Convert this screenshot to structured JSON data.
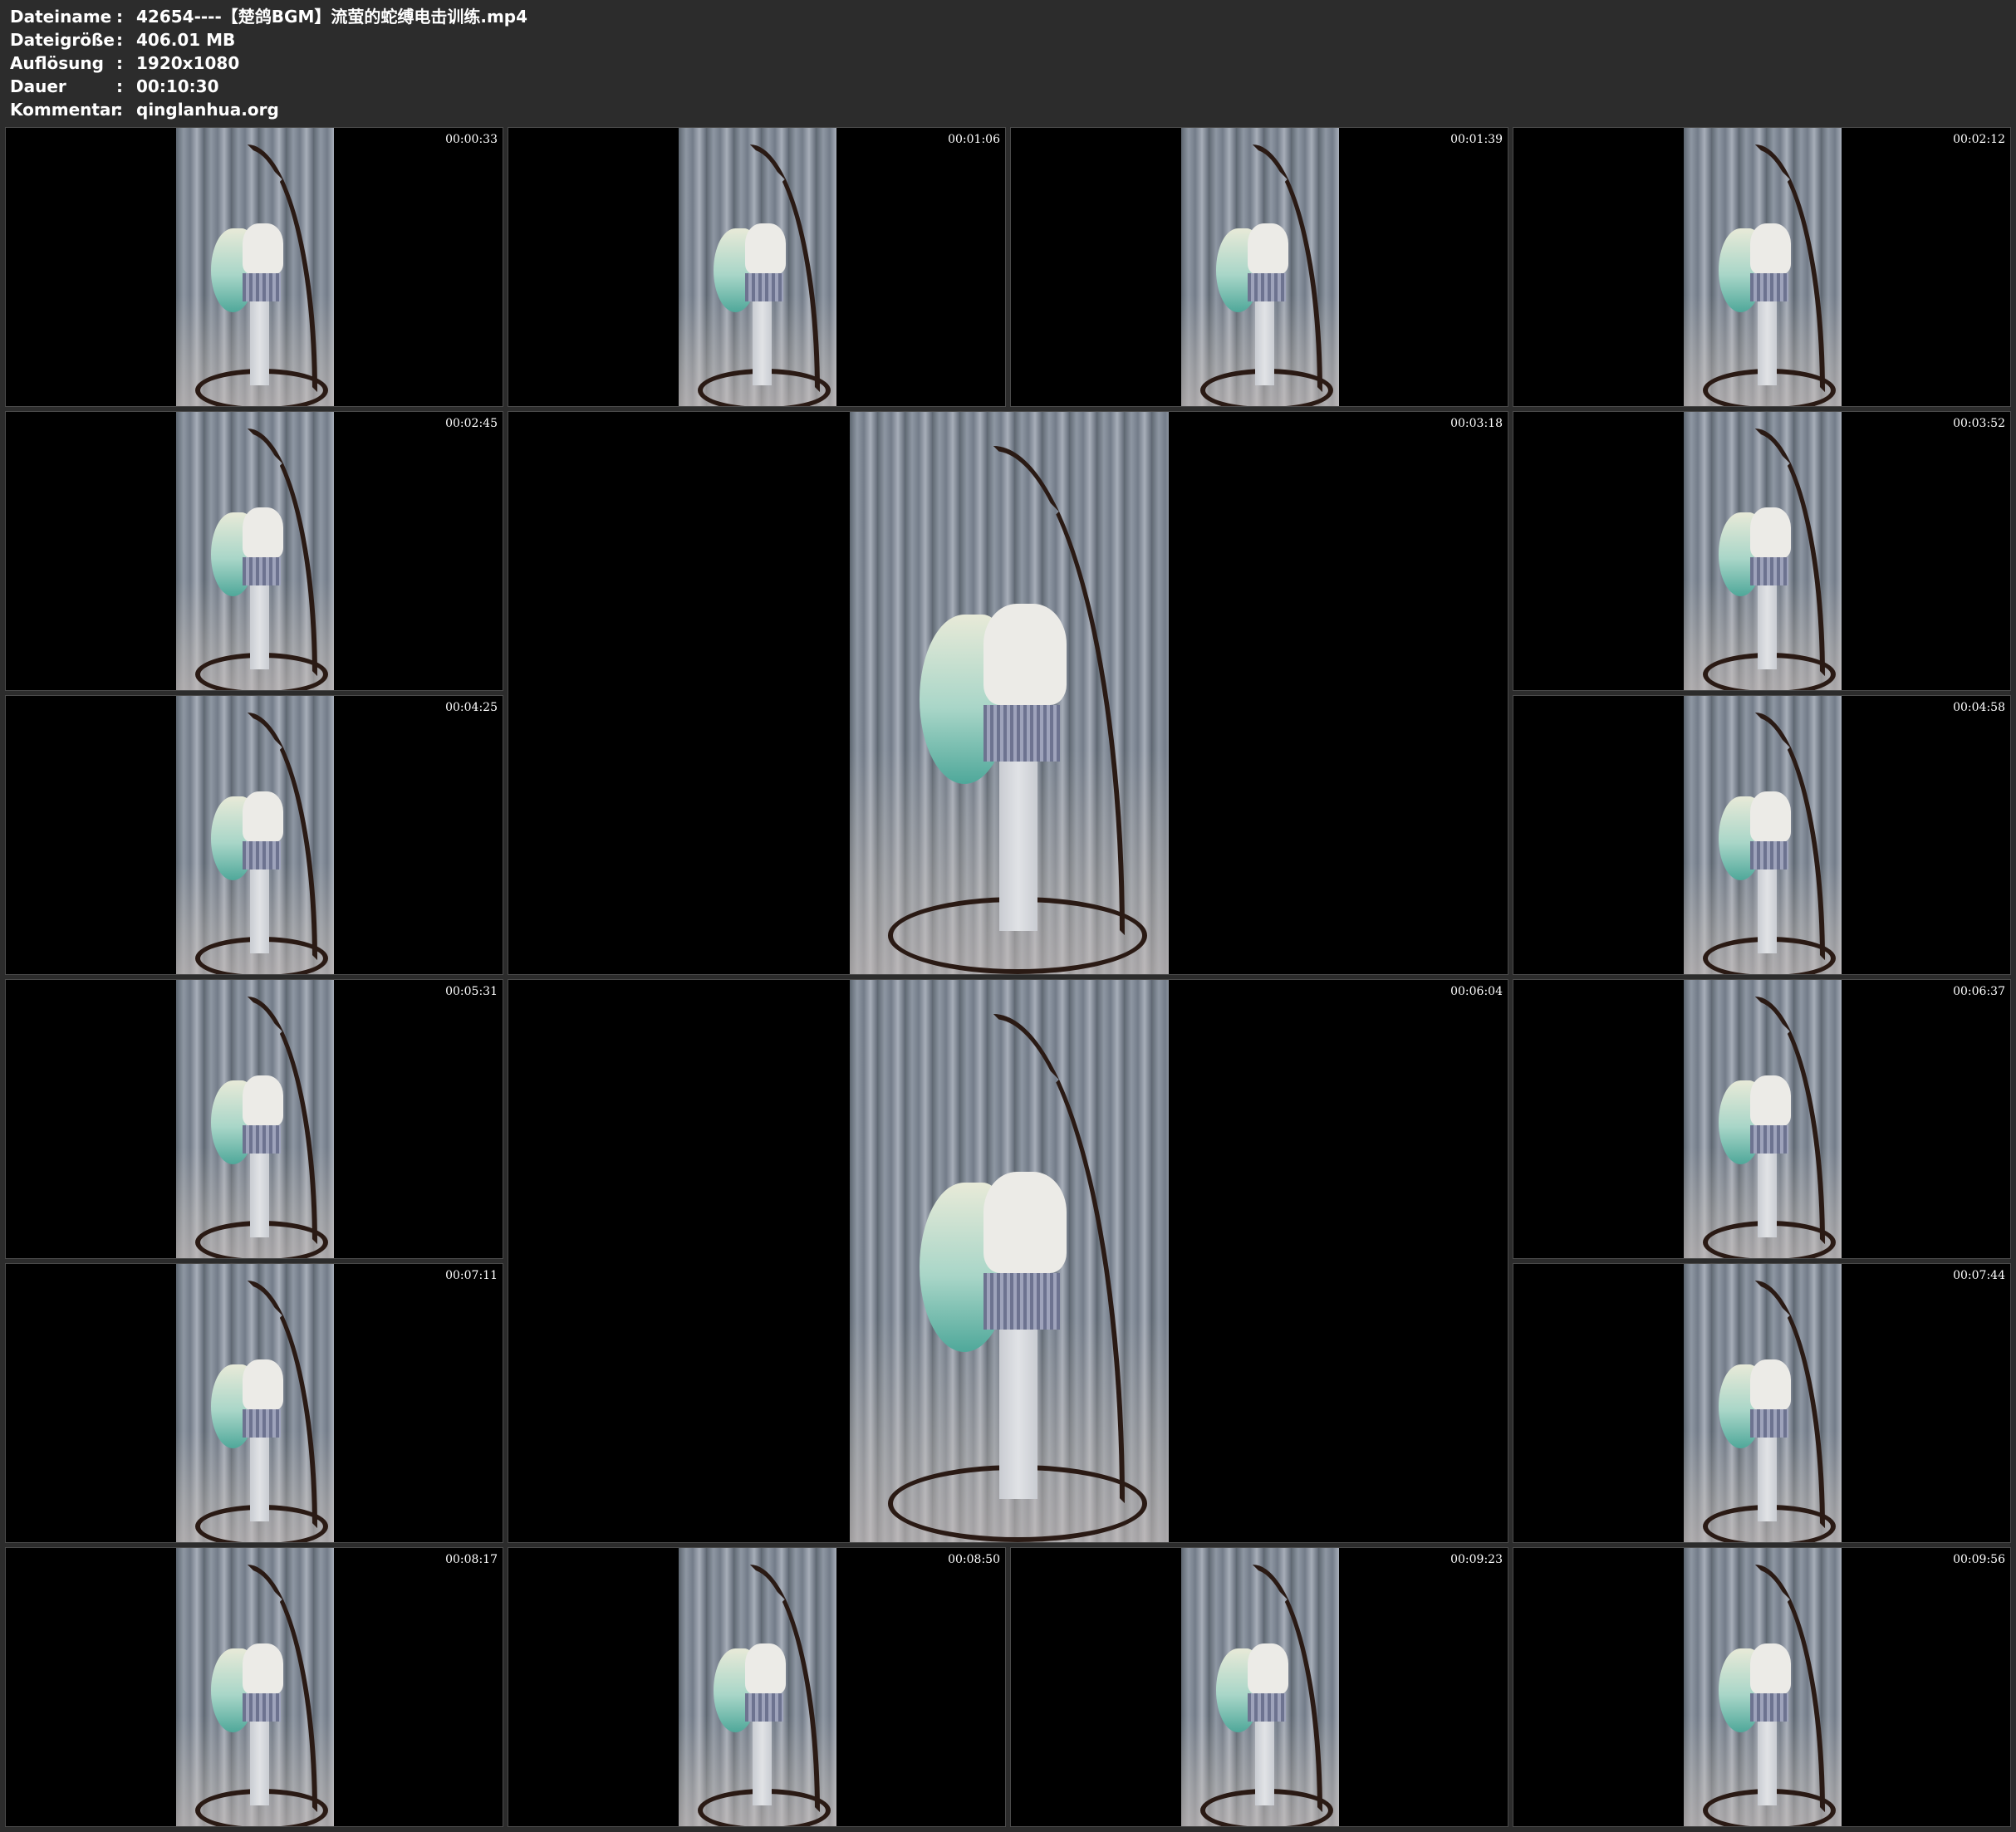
{
  "info": {
    "rows": [
      {
        "label": "Dateiname",
        "value": "42654----【楚鸽BGM】流萤的蛇缚电击训练.mp4"
      },
      {
        "label": "Dateigröße",
        "value": "406.01 MB"
      },
      {
        "label": "Auflösung",
        "value": "1920x1080"
      },
      {
        "label": "Dauer",
        "value": "00:10:30"
      },
      {
        "label": "Kommentar",
        "value": "qinglanhua.org"
      }
    ],
    "separator": ":"
  },
  "thumbnails": [
    {
      "time": "00:00:33"
    },
    {
      "time": "00:01:06"
    },
    {
      "time": "00:01:39"
    },
    {
      "time": "00:02:12"
    },
    {
      "time": "00:02:45"
    },
    {
      "time": "00:03:18"
    },
    {
      "time": "00:03:52"
    },
    {
      "time": "00:04:25"
    },
    {
      "time": "00:04:58"
    },
    {
      "time": "00:05:31"
    },
    {
      "time": "00:06:04"
    },
    {
      "time": "00:06:37"
    },
    {
      "time": "00:07:11"
    },
    {
      "time": "00:07:44"
    },
    {
      "time": "00:08:17"
    },
    {
      "time": "00:08:50"
    },
    {
      "time": "00:09:23"
    },
    {
      "time": "00:09:56"
    }
  ]
}
